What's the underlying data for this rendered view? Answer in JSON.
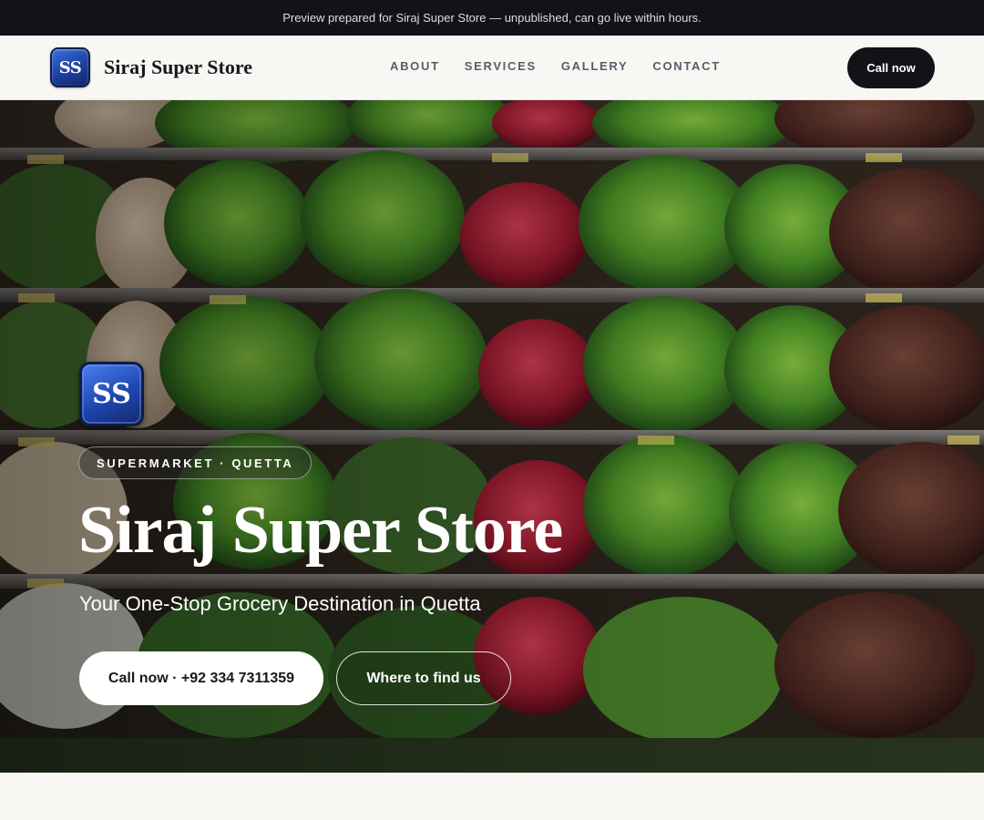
{
  "preview_bar": {
    "text": "Preview prepared for Siraj Super Store — unpublished, can go live within hours."
  },
  "header": {
    "logo_text": "SS",
    "brand_name": "Siraj Super Store",
    "nav": [
      "ABOUT",
      "SERVICES",
      "GALLERY",
      "CONTACT"
    ],
    "call_button": "Call now"
  },
  "hero": {
    "logo_text": "SS",
    "tag": "SUPERMARKET · QUETTA",
    "title": "Siraj Super Store",
    "subtitle": "Your One-Stop Grocery Destination in Quetta",
    "call_button": "Call now · +92 334 7311359",
    "find_button": "Where to find us",
    "background_image": "produce-shelves-photo"
  },
  "colors": {
    "dark": "#111318",
    "page_bg": "#f8f7f3",
    "logo_blue": "#1f46b0"
  }
}
